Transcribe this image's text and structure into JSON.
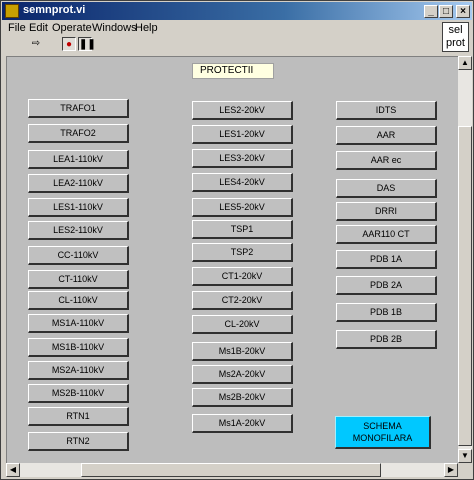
{
  "window": {
    "title": "semnprot.vi"
  },
  "menu": [
    "File",
    "Edit",
    "Operate",
    "Windows",
    "Help"
  ],
  "sel_prot": {
    "line1": "sel",
    "line2": "prot"
  },
  "panel_label": "PROTECTII",
  "columns": {
    "col1": [
      "TRAFO1",
      "TRAFO2",
      "LEA1-110kV",
      "LEA2-110kV",
      "LES1-110kV",
      "LES2-110kV",
      "CC-110kV",
      "CT-110kV",
      "CL-110kV",
      "MS1A-110kV",
      "MS1B-110kV",
      "MS2A-110kV",
      "MS2B-110kV",
      "RTN1",
      "RTN2"
    ],
    "col2": [
      "LES2-20kV",
      "LES1-20kV",
      "LES3-20kV",
      "LES4-20kV",
      "LES5-20kV",
      "TSP1",
      "TSP2",
      "CT1-20kV",
      "CT2-20kV",
      "CL-20kV",
      "Ms1B-20kV",
      "Ms2A-20kV",
      "Ms2B-20kV",
      "Ms1A-20kV"
    ],
    "col3": [
      "IDTS",
      "AAR",
      "AAR ec",
      "DAS",
      "DRRI",
      "AAR110 CT",
      "PDB 1A",
      "PDB 2A",
      "PDB 1B",
      "PDB 2B"
    ]
  },
  "schema_button": {
    "line1": "SCHEMA",
    "line2": "MONOFILARA",
    "color": "#00c8ff"
  }
}
